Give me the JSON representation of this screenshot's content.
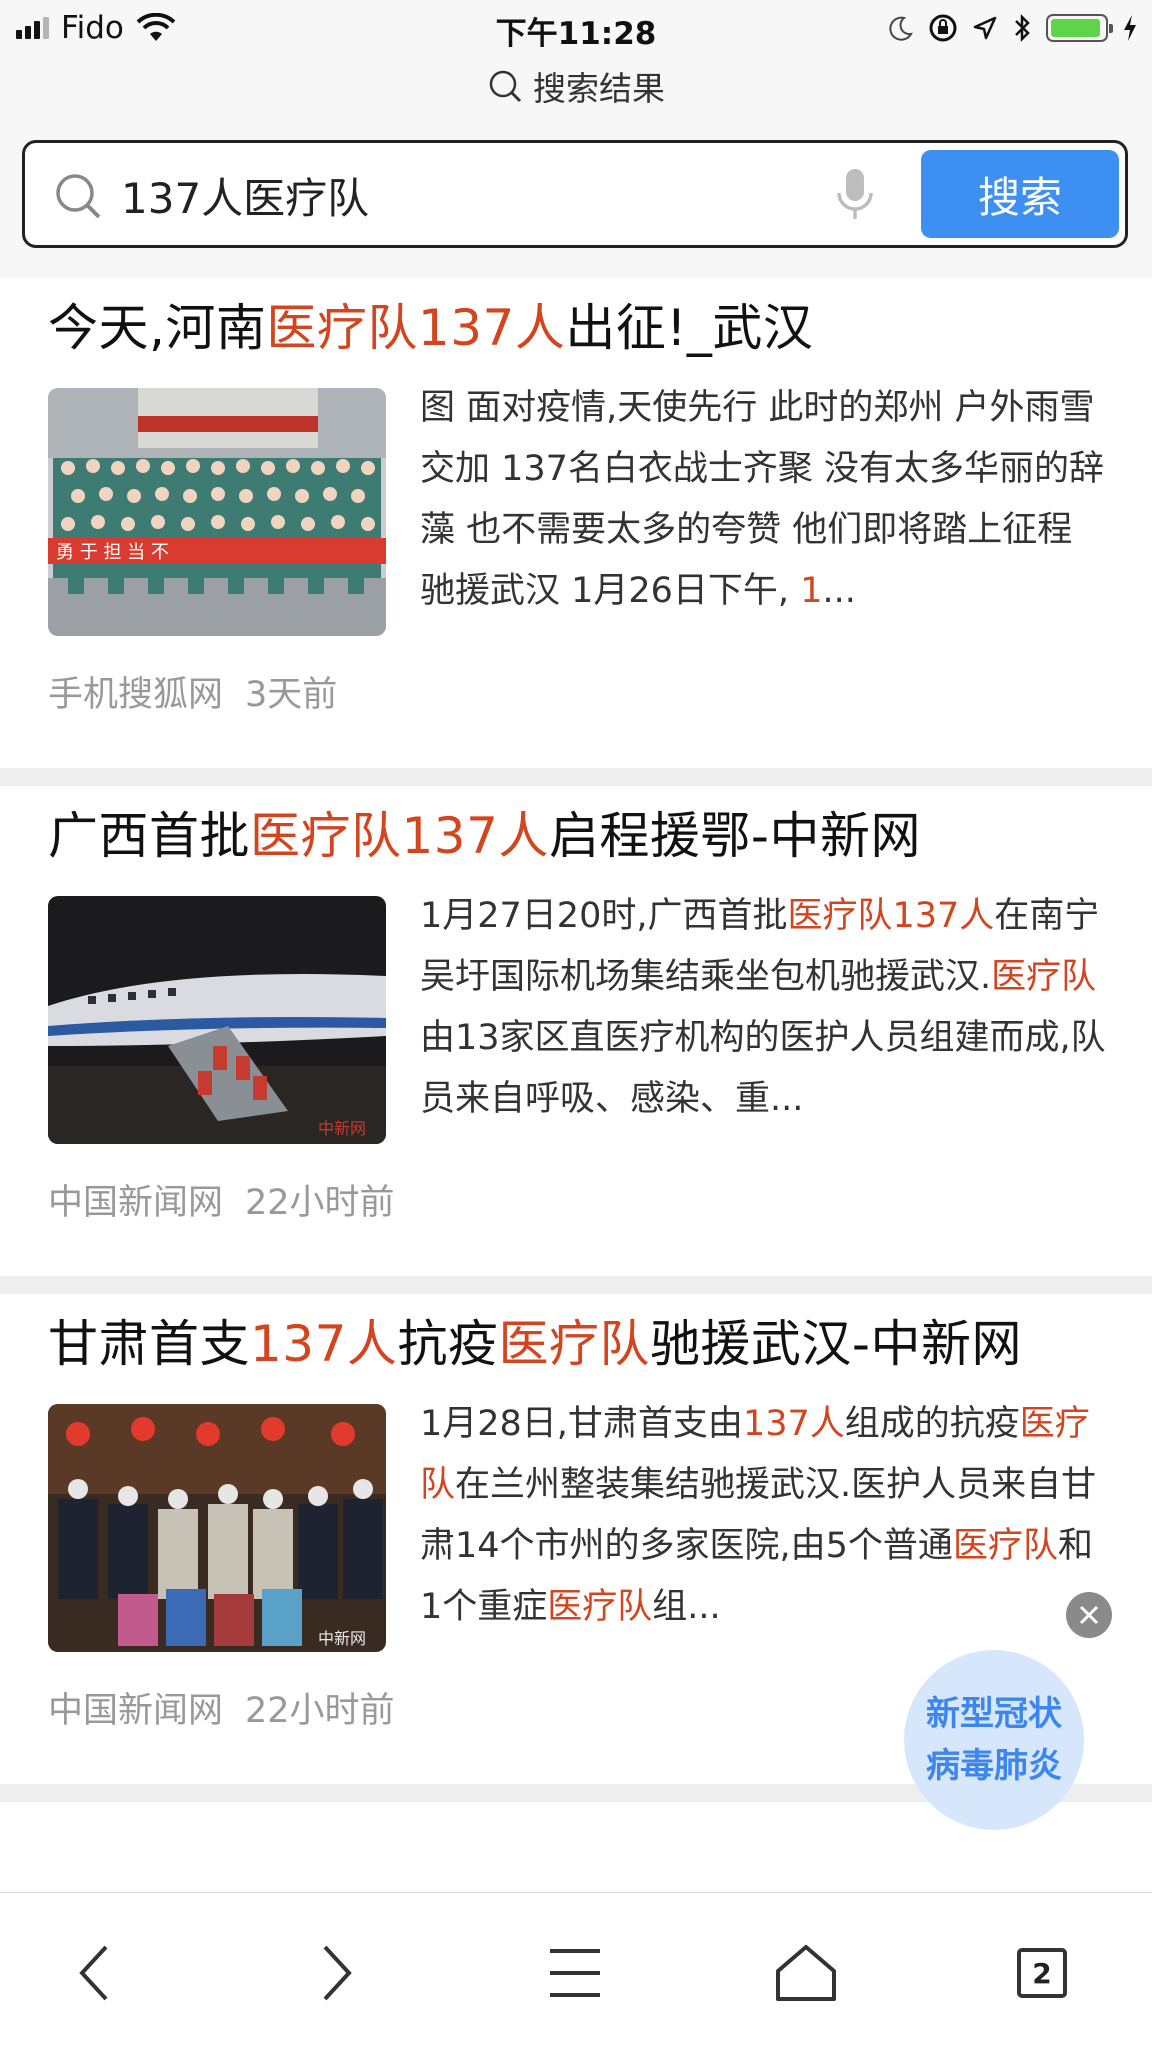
{
  "status_bar": {
    "carrier": "Fido",
    "time": "下午11:28",
    "battery_level": 0.85
  },
  "header": {
    "page_label": "搜索结果"
  },
  "search": {
    "query": "137人医疗队",
    "button_label": "搜索"
  },
  "results": [
    {
      "title": [
        "今天,河南",
        "医疗队137人",
        "出征!_武汉"
      ],
      "snippet": [
        "图 面对疫情,天使先行 此时的郑州 户外雨雪交加 137名白衣战士齐聚 没有太多华丽的辞藻 也不需要太多的夸赞 他们即将踏上征程 驰援武汉 1月26日下午, ",
        "1",
        "..."
      ],
      "source": "手机搜狐网",
      "time": "3天前",
      "thumbnail_banner_text": "勇 于 担 当 不"
    },
    {
      "title": [
        "广西首批",
        "医疗队137人",
        "启程援鄂-中新网"
      ],
      "snippet": [
        "1月27日20时,广西首批",
        "医疗队137人",
        "在南宁吴圩国际机场集结乘坐包机驰援武汉.",
        "医疗队",
        "由13家区直医疗机构的医护人员组建而成,队员来自呼吸、感染、重..."
      ],
      "source": "中国新闻网",
      "time": "22小时前",
      "thumbnail_watermark": "中新网"
    },
    {
      "title": [
        "甘肃首支",
        "137人",
        "抗疫",
        "医疗队",
        "驰援武汉-中新网"
      ],
      "snippet": [
        "1月28日,甘肃首支由",
        "137人",
        "组成的抗疫",
        "医疗队",
        "在兰州整装集结驰援武汉.医护人员来自甘肃14个市州的多家医院,由5个普通",
        "医疗队",
        "和1个重症",
        "医疗队",
        "组..."
      ],
      "source": "中国新闻网",
      "time": "22小时前",
      "thumbnail_watermark": "中新网"
    }
  ],
  "floating_badge": {
    "line1": "新型冠状",
    "line2": "病毒肺炎"
  },
  "toolbar": {
    "tab_count": "2",
    "icons": [
      "back-icon",
      "forward-icon",
      "menu-icon",
      "home-icon",
      "tabs-icon"
    ]
  },
  "colors": {
    "highlight": "#d2451e",
    "button_blue": "#3d8ff2",
    "badge_text": "#3d86ee",
    "meta_gray": "#999999"
  }
}
